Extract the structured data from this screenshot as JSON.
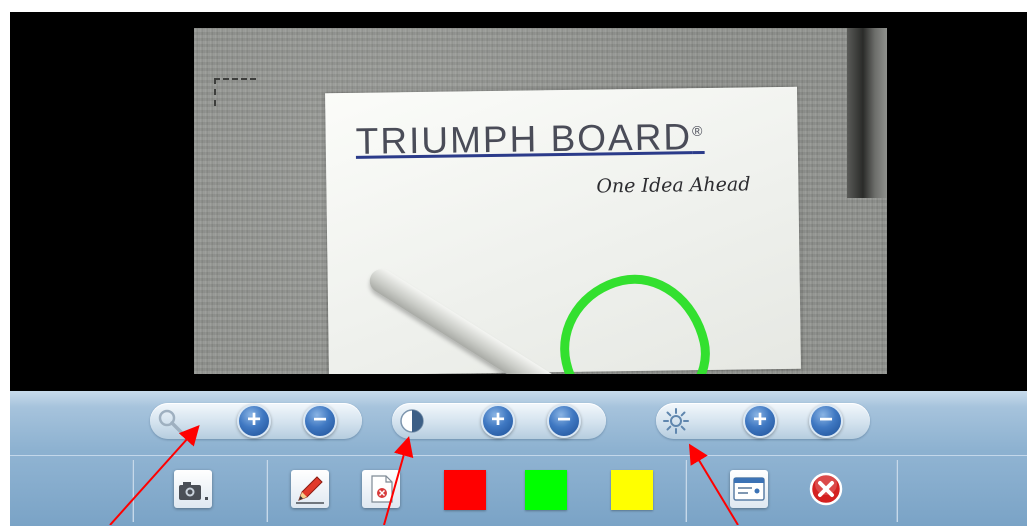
{
  "document": {
    "brand_text": "TRIUMPH BOARD",
    "brand_mark": "®",
    "tagline": "One Idea Ahead"
  },
  "toolbar": {
    "zoom": {
      "label_icon": "magnifier-icon",
      "increase_symbol": "+",
      "decrease_symbol": "−"
    },
    "contrast": {
      "label_icon": "contrast-icon",
      "increase_symbol": "+",
      "decrease_symbol": "−"
    },
    "brightness": {
      "label_icon": "sun-icon",
      "increase_symbol": "+",
      "decrease_symbol": "−"
    },
    "actions": [
      {
        "name": "capture-snapshot",
        "icon": "camera-icon"
      },
      {
        "name": "draw",
        "icon": "pencil-icon"
      },
      {
        "name": "erase",
        "icon": "eraser-icon"
      },
      {
        "name": "red-pen",
        "icon": "color-swatch"
      },
      {
        "name": "green-pen",
        "icon": "color-swatch"
      },
      {
        "name": "yellow-pen",
        "icon": "color-swatch"
      },
      {
        "name": "window-mode",
        "icon": "window-icon"
      },
      {
        "name": "close",
        "icon": "close-icon"
      }
    ],
    "colors": {
      "red": "#ff0000",
      "green": "#00ff00",
      "yellow": "#ffff00",
      "button_blue": "#2e63ad",
      "close_red": "#d42121"
    }
  },
  "annotation": {
    "pen_stroke_color": "#33e02f",
    "arrow_color": "#ff0000"
  }
}
